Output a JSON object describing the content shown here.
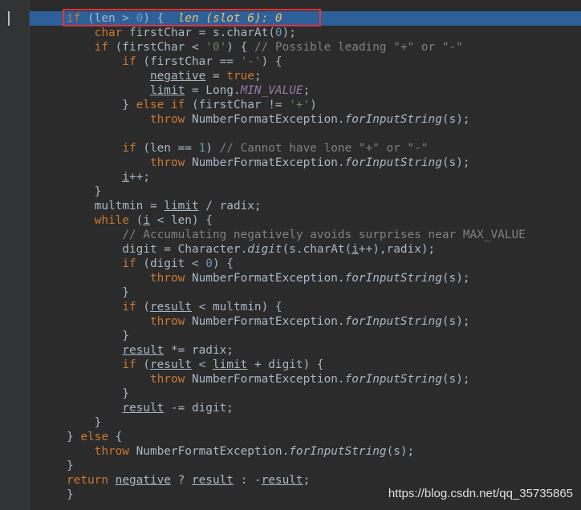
{
  "code": {
    "lines": [
      [
        {
          "t": "if",
          "c": "kw"
        },
        {
          "t": " (len > "
        },
        {
          "t": "0",
          "c": "num"
        },
        {
          "t": ") {  "
        },
        {
          "t": "len (slot 6): 0",
          "c": "dbg"
        }
      ],
      [
        {
          "t": "    "
        },
        {
          "t": "char",
          "c": "kw"
        },
        {
          "t": " firstChar = s.charAt("
        },
        {
          "t": "0",
          "c": "num"
        },
        {
          "t": ");"
        }
      ],
      [
        {
          "t": "    "
        },
        {
          "t": "if",
          "c": "kw"
        },
        {
          "t": " (firstChar < "
        },
        {
          "t": "'0'",
          "c": "str"
        },
        {
          "t": ") { "
        },
        {
          "t": "// Possible leading \"+\" or \"-\"",
          "c": "cmt"
        }
      ],
      [
        {
          "t": "        "
        },
        {
          "t": "if",
          "c": "kw"
        },
        {
          "t": " (firstChar == "
        },
        {
          "t": "'-'",
          "c": "str"
        },
        {
          "t": ") {"
        }
      ],
      [
        {
          "t": "            "
        },
        {
          "t": "negative",
          "c": "lv"
        },
        {
          "t": " = "
        },
        {
          "t": "true",
          "c": "kw"
        },
        {
          "t": ";"
        }
      ],
      [
        {
          "t": "            "
        },
        {
          "t": "limit",
          "c": "lv"
        },
        {
          "t": " = Long."
        },
        {
          "t": "MIN_VALUE",
          "c": "fld"
        },
        {
          "t": ";"
        }
      ],
      [
        {
          "t": "        } "
        },
        {
          "t": "else if",
          "c": "kw"
        },
        {
          "t": " (firstChar != "
        },
        {
          "t": "'+'",
          "c": "str"
        },
        {
          "t": ")"
        }
      ],
      [
        {
          "t": "            "
        },
        {
          "t": "throw",
          "c": "kw"
        },
        {
          "t": " NumberFormatException."
        },
        {
          "t": "forInputString",
          "c": "mth"
        },
        {
          "t": "(s);"
        }
      ],
      [
        {
          "t": ""
        }
      ],
      [
        {
          "t": "        "
        },
        {
          "t": "if",
          "c": "kw"
        },
        {
          "t": " (len == "
        },
        {
          "t": "1",
          "c": "num"
        },
        {
          "t": ") "
        },
        {
          "t": "// Cannot have lone \"+\" or \"-\"",
          "c": "cmt"
        }
      ],
      [
        {
          "t": "            "
        },
        {
          "t": "throw",
          "c": "kw"
        },
        {
          "t": " NumberFormatException."
        },
        {
          "t": "forInputString",
          "c": "mth"
        },
        {
          "t": "(s);"
        }
      ],
      [
        {
          "t": "        "
        },
        {
          "t": "i",
          "c": "lv"
        },
        {
          "t": "++;"
        }
      ],
      [
        {
          "t": "    }"
        }
      ],
      [
        {
          "t": "    multmin = "
        },
        {
          "t": "limit",
          "c": "lv"
        },
        {
          "t": " / radix;"
        }
      ],
      [
        {
          "t": "    "
        },
        {
          "t": "while",
          "c": "kw"
        },
        {
          "t": " ("
        },
        {
          "t": "i",
          "c": "lv"
        },
        {
          "t": " < len) {"
        }
      ],
      [
        {
          "t": "        "
        },
        {
          "t": "// Accumulating negatively avoids surprises near MAX_VALUE",
          "c": "cmt"
        }
      ],
      [
        {
          "t": "        digit = Character."
        },
        {
          "t": "digit",
          "c": "mth"
        },
        {
          "t": "(s.charAt("
        },
        {
          "t": "i",
          "c": "lv"
        },
        {
          "t": "++),radix);"
        }
      ],
      [
        {
          "t": "        "
        },
        {
          "t": "if",
          "c": "kw"
        },
        {
          "t": " (digit < "
        },
        {
          "t": "0",
          "c": "num"
        },
        {
          "t": ") {"
        }
      ],
      [
        {
          "t": "            "
        },
        {
          "t": "throw",
          "c": "kw"
        },
        {
          "t": " NumberFormatException."
        },
        {
          "t": "forInputString",
          "c": "mth"
        },
        {
          "t": "(s);"
        }
      ],
      [
        {
          "t": "        }"
        }
      ],
      [
        {
          "t": "        "
        },
        {
          "t": "if",
          "c": "kw"
        },
        {
          "t": " ("
        },
        {
          "t": "result",
          "c": "lv"
        },
        {
          "t": " < multmin) {"
        }
      ],
      [
        {
          "t": "            "
        },
        {
          "t": "throw",
          "c": "kw"
        },
        {
          "t": " NumberFormatException."
        },
        {
          "t": "forInputString",
          "c": "mth"
        },
        {
          "t": "(s);"
        }
      ],
      [
        {
          "t": "        }"
        }
      ],
      [
        {
          "t": "        "
        },
        {
          "t": "result",
          "c": "lv"
        },
        {
          "t": " *= radix;"
        }
      ],
      [
        {
          "t": "        "
        },
        {
          "t": "if",
          "c": "kw"
        },
        {
          "t": " ("
        },
        {
          "t": "result",
          "c": "lv"
        },
        {
          "t": " < "
        },
        {
          "t": "limit",
          "c": "lv"
        },
        {
          "t": " + digit) {"
        }
      ],
      [
        {
          "t": "            "
        },
        {
          "t": "throw",
          "c": "kw"
        },
        {
          "t": " NumberFormatException."
        },
        {
          "t": "forInputString",
          "c": "mth"
        },
        {
          "t": "(s);"
        }
      ],
      [
        {
          "t": "        }"
        }
      ],
      [
        {
          "t": "        "
        },
        {
          "t": "result",
          "c": "lv"
        },
        {
          "t": " -= digit;"
        }
      ],
      [
        {
          "t": "    }"
        }
      ],
      [
        {
          "t": "} "
        },
        {
          "t": "else",
          "c": "kw"
        },
        {
          "t": " {"
        }
      ],
      [
        {
          "t": "    "
        },
        {
          "t": "throw",
          "c": "kw"
        },
        {
          "t": " NumberFormatException."
        },
        {
          "t": "forInputString",
          "c": "mth"
        },
        {
          "t": "(s);"
        }
      ],
      [
        {
          "t": "}"
        }
      ],
      [
        {
          "t": "return",
          "c": "kw"
        },
        {
          "t": " "
        },
        {
          "t": "negative",
          "c": "lv"
        },
        {
          "t": " ? "
        },
        {
          "t": "result",
          "c": "lv"
        },
        {
          "t": " : -"
        },
        {
          "t": "result",
          "c": "lv"
        },
        {
          "t": ";"
        }
      ],
      [
        {
          "t": "}"
        }
      ]
    ]
  },
  "colors": {
    "background": "#2b2b2b",
    "keyword": "#cc7832",
    "number": "#6897bb",
    "string": "#6a8759",
    "comment": "#808080",
    "field": "#9876aa",
    "inline_debug_value": "#e8bf6a",
    "execution_line": "#2d6099",
    "annotation_box": "#e0323a"
  },
  "watermark": "https://blog.csdn.net/qq_35735865"
}
